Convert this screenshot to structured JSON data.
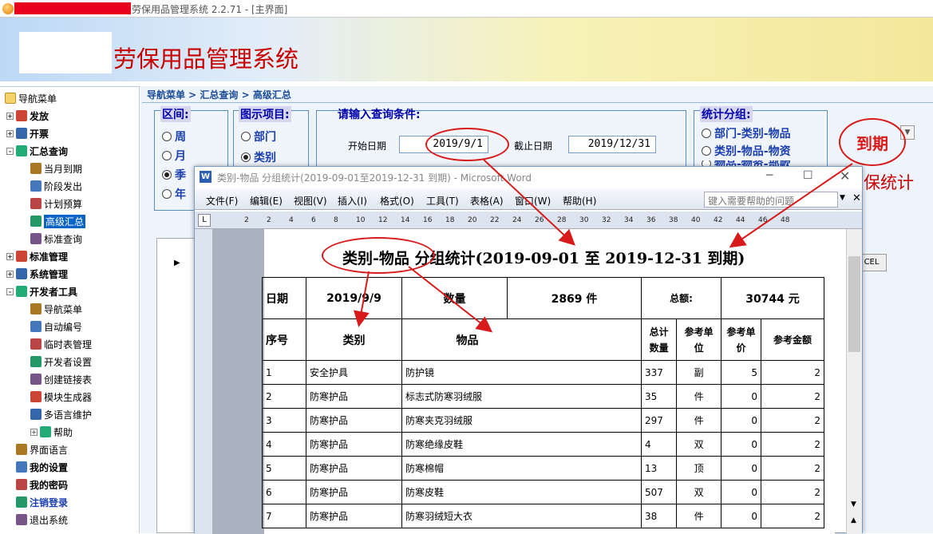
{
  "window": {
    "title": "劳保用品管理系统 2.2.71 - [主界面]"
  },
  "banner": {
    "title": "劳保用品管理系统"
  },
  "nav": {
    "root": "导航菜单",
    "items": [
      {
        "label": "发放",
        "level": 0,
        "expand": "+",
        "bold": true
      },
      {
        "label": "开票",
        "level": 0,
        "expand": "+",
        "bold": true
      },
      {
        "label": "汇总查询",
        "level": 0,
        "expand": "-",
        "bold": true
      },
      {
        "label": "当月到期",
        "level": 1
      },
      {
        "label": "阶段发出",
        "level": 1
      },
      {
        "label": "计划预算",
        "level": 1
      },
      {
        "label": "高级汇总",
        "level": 1,
        "selected": true
      },
      {
        "label": "标准查询",
        "level": 1
      },
      {
        "label": "标准管理",
        "level": 0,
        "expand": "+",
        "bold": true
      },
      {
        "label": "系统管理",
        "level": 0,
        "expand": "+",
        "bold": true
      },
      {
        "label": "开发者工具",
        "level": 0,
        "expand": "-",
        "bold": true
      },
      {
        "label": "导航菜单",
        "level": 1
      },
      {
        "label": "自动编号",
        "level": 1
      },
      {
        "label": "临时表管理",
        "level": 1
      },
      {
        "label": "开发者设置",
        "level": 1
      },
      {
        "label": "创建链接表",
        "level": 1
      },
      {
        "label": "模块生成器",
        "level": 1
      },
      {
        "label": "多语言维护",
        "level": 1
      },
      {
        "label": "帮助",
        "level": 1,
        "expand": "+"
      },
      {
        "label": "界面语言",
        "level": 0
      },
      {
        "label": "我的设置",
        "level": 0,
        "bold": true
      },
      {
        "label": "我的密码",
        "level": 0,
        "bold": true
      },
      {
        "label": "注销登录",
        "level": 0,
        "bold": true,
        "blue": true
      },
      {
        "label": "退出系统",
        "level": 0
      }
    ]
  },
  "breadcrumb": "导航菜单 > 汇总查询 > 高级汇总",
  "interval": {
    "title": "区间:",
    "options": [
      "周",
      "月",
      "季",
      "年"
    ]
  },
  "chart_items": {
    "title": "图示项目:",
    "options": [
      "部门",
      "类别"
    ]
  },
  "query": {
    "title": "请输入查询条件:",
    "start_label": "开始日期",
    "start_value": "2019/9/1",
    "end_label": "截止日期",
    "end_value": "2019/12/31"
  },
  "stat_group": {
    "title": "统计分组:",
    "options": [
      "部门-类别-物品",
      "类别-物品-物资",
      "物品-物资-部款"
    ]
  },
  "annotation": {
    "due_label": "到期",
    "stat_label": "保统计",
    "excel_label": "CEL"
  },
  "word": {
    "title": "类别-物品 分组统计(2019-09-01至2019-12-31 到期) - Microsoft Word",
    "menu": [
      "文件(F)",
      "编辑(E)",
      "视图(V)",
      "插入(I)",
      "格式(O)",
      "工具(T)",
      "表格(A)",
      "窗口(W)",
      "帮助(H)"
    ],
    "help_placeholder": "键入需要帮助的问题",
    "ruler": [
      "2",
      "2",
      "4",
      "6",
      "8",
      "10",
      "12",
      "14",
      "16",
      "18",
      "20",
      "22",
      "24",
      "26",
      "28",
      "30",
      "32",
      "34",
      "36",
      "38",
      "40",
      "42",
      "44",
      "46",
      "48"
    ],
    "doc_title": "类别-物品  分组统计(2019-09-01 至 2019-12-31  到期)",
    "summary": {
      "date_label": "日期",
      "date_value": "2019/9/9",
      "qty_label": "数量",
      "qty_value": "2869 件",
      "total_label": "总额:",
      "total_value": "30744 元"
    },
    "headers": {
      "no": "序号",
      "cat": "类别",
      "item": "物品",
      "qty": "总计数量",
      "unit": "参考单位",
      "price": "参考单价",
      "amount": "参考金额"
    },
    "rows": [
      {
        "no": "1",
        "cat": "安全护具",
        "item": "防护镜",
        "qty": "337",
        "unit": "副",
        "price": "5",
        "amount": "2"
      },
      {
        "no": "2",
        "cat": "防寒护品",
        "item": "标志式防寒羽绒服",
        "qty": "35",
        "unit": "件",
        "price": "0",
        "amount": "2"
      },
      {
        "no": "3",
        "cat": "防寒护品",
        "item": "防寒夹克羽绒服",
        "qty": "297",
        "unit": "件",
        "price": "0",
        "amount": "2"
      },
      {
        "no": "4",
        "cat": "防寒护品",
        "item": "防寒绝缘皮鞋",
        "qty": "4",
        "unit": "双",
        "price": "0",
        "amount": "2"
      },
      {
        "no": "5",
        "cat": "防寒护品",
        "item": "防寒棉帽",
        "qty": "13",
        "unit": "顶",
        "price": "0",
        "amount": "2"
      },
      {
        "no": "6",
        "cat": "防寒护品",
        "item": "防寒皮鞋",
        "qty": "507",
        "unit": "双",
        "price": "0",
        "amount": "2"
      },
      {
        "no": "7",
        "cat": "防寒护品",
        "item": "防寒羽绒短大衣",
        "qty": "38",
        "unit": "件",
        "price": "0",
        "amount": "2"
      }
    ]
  },
  "colors": {
    "banner_title": "#c80000",
    "annotation": "#d81a1a",
    "link": "#1b3fb0"
  }
}
